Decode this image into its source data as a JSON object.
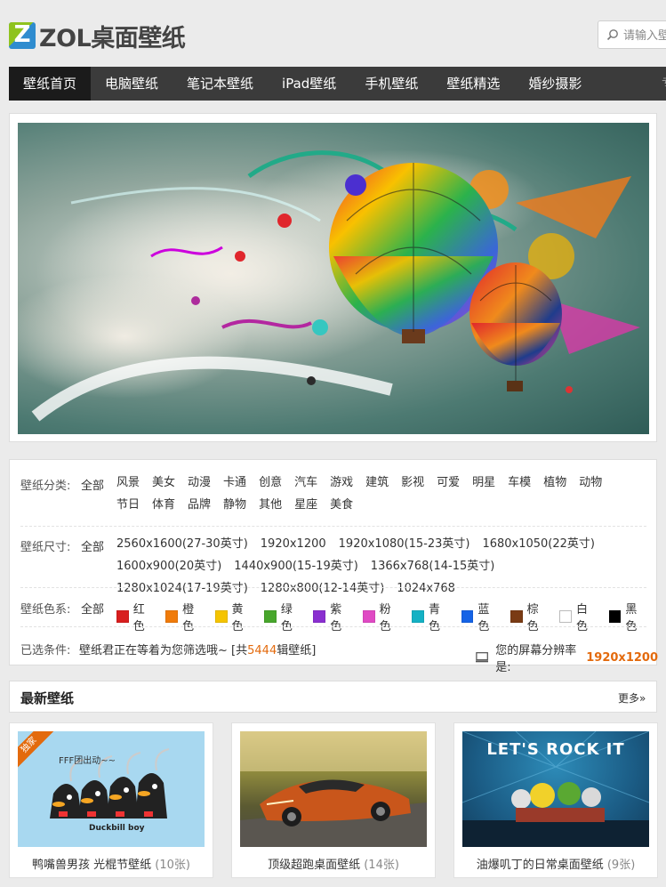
{
  "header": {
    "logo_text": "ZOL桌面壁纸",
    "logo_letter": "Z",
    "search_placeholder": "请输入壁纸"
  },
  "nav": {
    "items": [
      {
        "label": "壁纸首页",
        "active": true
      },
      {
        "label": "电脑壁纸"
      },
      {
        "label": "笔记本壁纸"
      },
      {
        "label": "iPad壁纸"
      },
      {
        "label": "手机壁纸"
      },
      {
        "label": "壁纸精选"
      },
      {
        "label": "婚纱摄影"
      }
    ],
    "overflow": "专"
  },
  "filter": {
    "category": {
      "label": "壁纸分类:",
      "all": "全部",
      "tags": [
        "风景",
        "美女",
        "动漫",
        "卡通",
        "创意",
        "汽车",
        "游戏",
        "建筑",
        "影视",
        "可爱",
        "明星",
        "车模",
        "植物",
        "动物",
        "节日",
        "体育",
        "品牌",
        "静物",
        "其他",
        "星座",
        "美食"
      ]
    },
    "size": {
      "label": "壁纸尺寸:",
      "all": "全部",
      "tags": [
        "2560x1600(27-30英寸)",
        "1920x1200",
        "1920x1080(15-23英寸)",
        "1680x1050(22英寸)",
        "1600x900(20英寸)",
        "1440x900(15-19英寸)",
        "1366x768(14-15英寸)",
        "1280x1024(17-19英寸)",
        "1280x800(12-14英寸)",
        "1024x768"
      ]
    },
    "color": {
      "label": "壁纸色系:",
      "all": "全部",
      "items": [
        {
          "name": "红色",
          "hex": "#d81e1e"
        },
        {
          "name": "橙色",
          "hex": "#f07b0a"
        },
        {
          "name": "黄色",
          "hex": "#f5c400"
        },
        {
          "name": "绿色",
          "hex": "#48a62c"
        },
        {
          "name": "紫色",
          "hex": "#8a2fd0"
        },
        {
          "name": "粉色",
          "hex": "#e04ac4"
        },
        {
          "name": "青色",
          "hex": "#14b1c4"
        },
        {
          "name": "蓝色",
          "hex": "#1563e6"
        },
        {
          "name": "棕色",
          "hex": "#7a3b14"
        },
        {
          "name": "白色",
          "hex": "#ffffff"
        },
        {
          "name": "黑色",
          "hex": "#000000"
        }
      ]
    },
    "selected": {
      "label": "已选条件:",
      "text": "壁纸君正在等着为您筛选哦~",
      "count_prefix": "[共",
      "count": "5444",
      "count_suffix": "辑壁纸]",
      "resolution_label": "您的屏幕分辨率是:",
      "resolution": "1920x1200"
    }
  },
  "latest": {
    "title": "最新壁纸",
    "more": "更多»",
    "cards": [
      {
        "title": "鸭嘴兽男孩 光棍节壁纸",
        "count": "(10张)",
        "badge": "独家",
        "thumb_text": "FFF团出动~~",
        "thumb_brand": "Duckbill boy"
      },
      {
        "title": "顶级超跑桌面壁纸",
        "count": "(14张)"
      },
      {
        "title": "油爆叽丁的日常桌面壁纸",
        "count": "(9张)",
        "thumb_text": "LET'S ROCK IT"
      }
    ]
  },
  "accent_color": "#e36a0d",
  "nav_bg": "#3b3b3b"
}
